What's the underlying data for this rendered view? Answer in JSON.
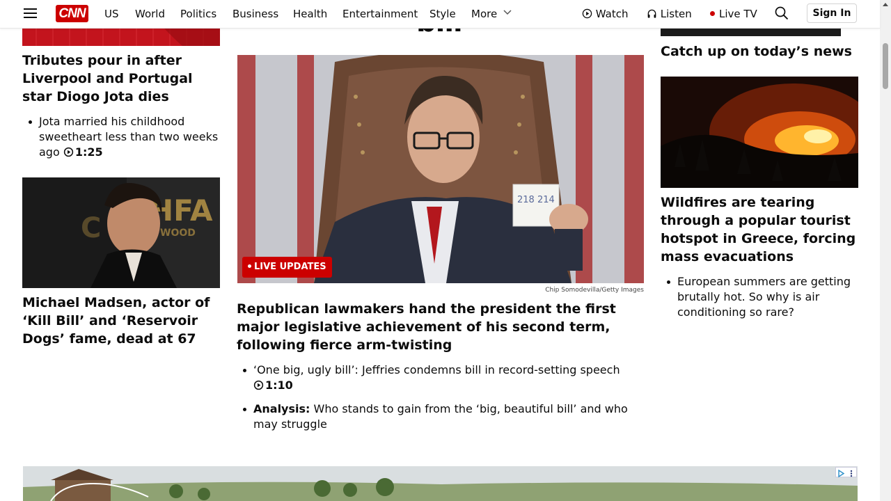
{
  "header": {
    "logo": "CNN",
    "nav": [
      "US",
      "World",
      "Politics",
      "Business",
      "Health",
      "Entertainment",
      "Style",
      "More"
    ],
    "watch_label": "Watch",
    "listen_label": "Listen",
    "live_tv_label": "Live TV",
    "sign_in_label": "Sign In"
  },
  "left": {
    "story1": {
      "headline": "Tributes pour in after Liverpool and Portugal star Diogo Jota dies",
      "bullet": "Jota married his childhood sweetheart less than two weeks ago",
      "video_duration": "1:25"
    },
    "story2": {
      "headline": "Michael Madsen, actor of ‘Kill Bill’ and ‘Reservoir Dogs’ fame, dead at 67"
    }
  },
  "center": {
    "title_fragment": "bill",
    "live_badge": "LIVE UPDATES",
    "image_credit": "Chip Somodevilla/Getty Images",
    "card_numbers": "218   214",
    "headline": "Republican lawmakers hand the president the first major legislative achievement of his second term, following fierce arm-twisting",
    "bullet1": "‘One big, ugly bill’: Jeffries condemns bill in record-setting speech",
    "bullet1_video_duration": "1:10",
    "bullet2_label": "Analysis:",
    "bullet2_text": " Who stands to gain from the ‘big, beautiful bill’ and who may struggle"
  },
  "right": {
    "section_title": "Catch up on today’s news",
    "story1": {
      "headline": "Wildfires are tearing through a popular tourist hotspot in Greece, forcing mass evacuations",
      "bullet": "European summers are getting brutally hot. So why is air conditioning so rare?"
    }
  },
  "colors": {
    "brand_red": "#cc0000",
    "text": "#0c0c0c"
  }
}
